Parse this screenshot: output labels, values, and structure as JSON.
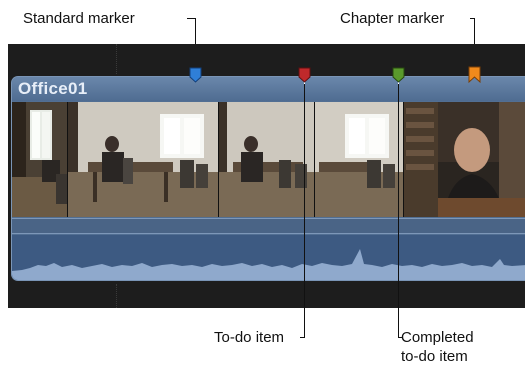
{
  "callouts": {
    "standard_marker": "Standard marker",
    "chapter_marker": "Chapter marker",
    "todo_item": "To-do item",
    "completed_line1": "Completed",
    "completed_line2": "to-do item"
  },
  "clip": {
    "name": "Office01"
  },
  "markers": [
    {
      "type": "standard",
      "color": "#2f7fd8"
    },
    {
      "type": "to-do",
      "color": "#c0292b"
    },
    {
      "type": "completed-to-do",
      "color": "#5a9a2c"
    },
    {
      "type": "chapter",
      "color": "#f08a1c"
    }
  ],
  "colors": {
    "timeline_bg": "#1d1d1d",
    "clip": "#526f93",
    "audio_wave": "#8fa9cc"
  }
}
